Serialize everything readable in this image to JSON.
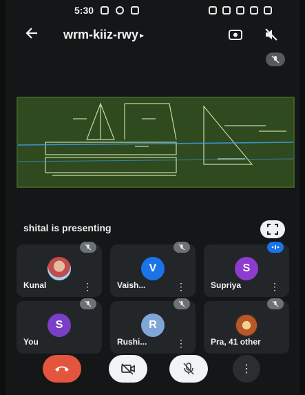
{
  "status_bar": {
    "time": "5:30"
  },
  "header": {
    "meeting_code": "wrm-kiiz-rwy"
  },
  "presentation": {
    "presenter_text": "shital is presenting"
  },
  "participants": [
    {
      "name": "Kunal",
      "type": "photo",
      "mic": "muted"
    },
    {
      "name": "Vaish...",
      "type": "initial",
      "initial": "V",
      "color": "#1a73e8",
      "mic": "muted"
    },
    {
      "name": "Supriya",
      "type": "initial",
      "initial": "S",
      "color": "#8e3ccf",
      "mic": "speaking"
    },
    {
      "name": "You",
      "type": "initial",
      "initial": "S",
      "color": "#7a3fc7",
      "mic": "muted"
    },
    {
      "name": "Rushi...",
      "type": "initial",
      "initial": "R",
      "color": "#7fa6d6",
      "mic": "muted"
    },
    {
      "name": "Pra, 41 other",
      "type": "photo2",
      "mic": "muted"
    }
  ],
  "controls": {
    "end_call": "end-call-icon",
    "camera": "camera-off-icon",
    "mic": "mic-off-icon",
    "more": "more-vert-icon"
  },
  "colors": {
    "background": "#141617",
    "tile": "#232629",
    "end_call": "#e4553d",
    "accent_blue": "#1a73e8",
    "board_green": "#2f4a1e"
  }
}
